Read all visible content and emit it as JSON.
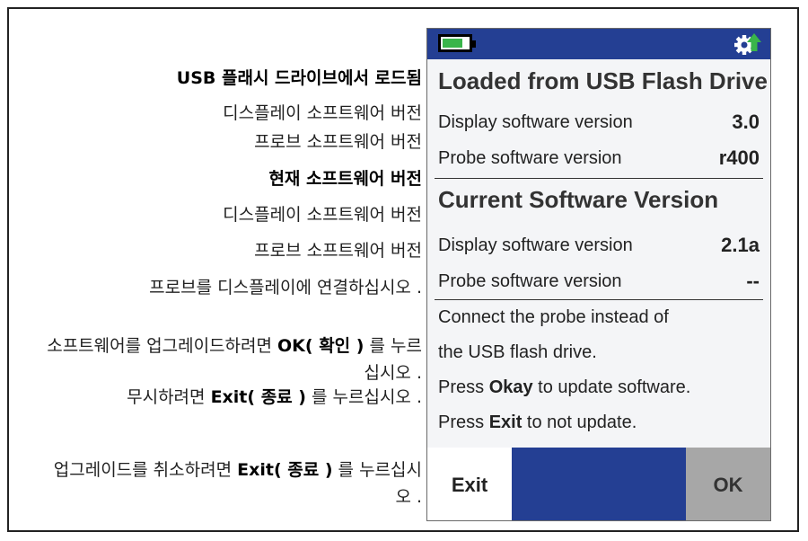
{
  "annotations_ko": {
    "loaded_from_usb": "USB 플래시 드라이브에서 로드됨",
    "display_sw_version_1": "디스플레이 소프트웨어 버전",
    "probe_sw_version_1": "프로브 소프트웨어 버전",
    "current_sw_version": "현재 소프트웨어 버전",
    "display_sw_version_2": "디스플레이 소프트웨어 버전",
    "probe_sw_version_2": "프로브 소프트웨어 버전",
    "connect_probe": "프로브를 디스플레이에 연결하십시오 .",
    "upgrade_pre": "소프트웨어를 업그레이드하려면 ",
    "upgrade_bold": "OK( 확인 )",
    "upgrade_post": " 를 누르십시오 .",
    "ignore_pre": "무시하려면 ",
    "ignore_bold": "Exit( 종료 )",
    "ignore_post": " 를 누르십시오 .",
    "cancel_pre": "업그레이드를 취소하려면 ",
    "cancel_bold": "Exit( 종료 )",
    "cancel_post": " 를 누르십시오 ."
  },
  "device": {
    "loaded_header": "Loaded from USB Flash Drive",
    "loaded_display_label": "Display software version",
    "loaded_display_value": "3.0",
    "loaded_probe_label": "Probe software version",
    "loaded_probe_value": "r400",
    "current_header": "Current Software Version",
    "current_display_label": "Display software version",
    "current_display_value": "2.1a",
    "current_probe_label": "Probe software version",
    "current_probe_value": "--",
    "msg_connect_1": "Connect the probe instead of",
    "msg_connect_2": "the USB flash drive.",
    "msg_press_1_pre": "Press ",
    "msg_press_1_bold": "Okay",
    "msg_press_1_post": " to update software.",
    "msg_press_2_pre": "Press ",
    "msg_press_2_bold": "Exit",
    "msg_press_2_post": " to not update.",
    "exit_label": "Exit",
    "ok_label": "OK"
  },
  "icons": {
    "battery": "battery-icon",
    "settings": "settings-update-icon"
  },
  "colors": {
    "bar_blue": "#243f93",
    "battery_green": "#39b54a",
    "ok_gray": "#a7a7a7"
  }
}
